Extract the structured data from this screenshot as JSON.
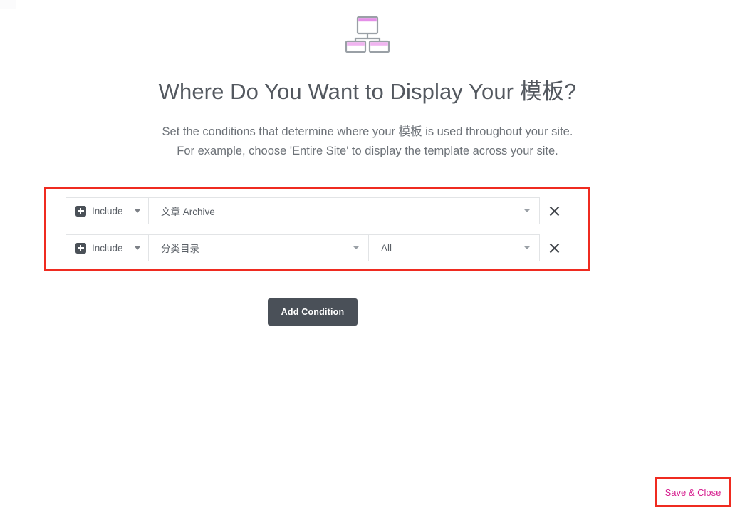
{
  "hero": {
    "icon": "sitemap-icon",
    "box_fill": "#ffffff",
    "box_stroke": "#9aa0a6",
    "accent": "#e08fe0"
  },
  "heading": {
    "title": "Where Do You Want to Display Your 模板?",
    "subtitle_line_1": "Set the conditions that determine where your 模板 is used throughout your site.",
    "subtitle_line_2": "For example, choose 'Entire Site' to display the template across your site."
  },
  "conditions": {
    "annotation_color": "#ef2b20",
    "rows": [
      {
        "type_icon": "plus-square-icon",
        "type_label": "Include",
        "object_label": "文章 Archive",
        "has_subobject": false,
        "subobject_label": "",
        "remove_icon": "close-icon"
      },
      {
        "type_icon": "plus-square-icon",
        "type_label": "Include",
        "object_label": "分类目录",
        "has_subobject": true,
        "subobject_label": "All",
        "remove_icon": "close-icon"
      }
    ]
  },
  "actions": {
    "add_condition_label": "Add Condition",
    "add_condition_bg": "#4a5058"
  },
  "footer": {
    "save_close_label": "Save & Close",
    "save_close_color": "#d61f8f",
    "annotation_color": "#ef2b20"
  }
}
